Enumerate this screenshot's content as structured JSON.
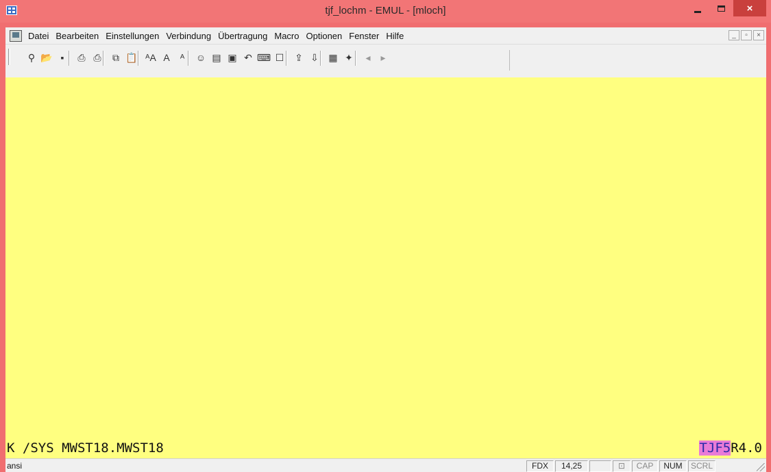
{
  "window": {
    "title": "tjf_lochm - EMUL - [mloch]",
    "close_glyph": "×",
    "app_icon": "terminal-app-icon"
  },
  "menu": {
    "items": [
      "Datei",
      "Bearbeiten",
      "Einstellungen",
      "Verbindung",
      "Übertragung",
      "Macro",
      "Optionen",
      "Fenster",
      "Hilfe"
    ],
    "mdi_buttons": [
      "_",
      "▫",
      "×"
    ]
  },
  "toolbar": {
    "icons": [
      {
        "name": "connect-icon",
        "glyph": "⚲"
      },
      {
        "name": "open-icon",
        "glyph": "📂"
      },
      {
        "name": "save-icon",
        "glyph": "▪"
      },
      {
        "name": "print-setup-icon",
        "glyph": "⎙"
      },
      {
        "name": "print-icon",
        "glyph": "⎙"
      },
      {
        "name": "copy-icon",
        "glyph": "⧉"
      },
      {
        "name": "paste-icon",
        "glyph": "📋"
      },
      {
        "name": "font-select-icon",
        "glyph": "ᴬA"
      },
      {
        "name": "font-larger-icon",
        "glyph": "A"
      },
      {
        "name": "font-smaller-icon",
        "glyph": "ᴬ"
      },
      {
        "name": "color-palette-icon",
        "glyph": "☺"
      },
      {
        "name": "screen-settings-icon",
        "glyph": "▤"
      },
      {
        "name": "edit-icon",
        "glyph": "▣"
      },
      {
        "name": "undo-icon",
        "glyph": "↶"
      },
      {
        "name": "keyboard-icon",
        "glyph": "⌨"
      },
      {
        "name": "properties-icon",
        "glyph": "☐"
      },
      {
        "name": "transfer-send-icon",
        "glyph": "⇪"
      },
      {
        "name": "transfer-receive-icon",
        "glyph": "⇩"
      },
      {
        "name": "keypad-icon",
        "glyph": "▦"
      },
      {
        "name": "macro-icon",
        "glyph": "✦"
      },
      {
        "name": "back-icon",
        "glyph": "◂"
      },
      {
        "name": "forward-icon",
        "glyph": "▸"
      }
    ]
  },
  "terminal": {
    "background": "#ffff80",
    "command_line": "K /SYS MWST18.MWST18",
    "right_highlight": "TJF5",
    "right_suffix": "R4.0",
    "highlight_color": "#e97bd7"
  },
  "statusbar": {
    "text": "ansi",
    "fdx": "FDX",
    "cursor": "14,25",
    "cap": "CAP",
    "num": "NUM",
    "scrl": "SCRL"
  }
}
